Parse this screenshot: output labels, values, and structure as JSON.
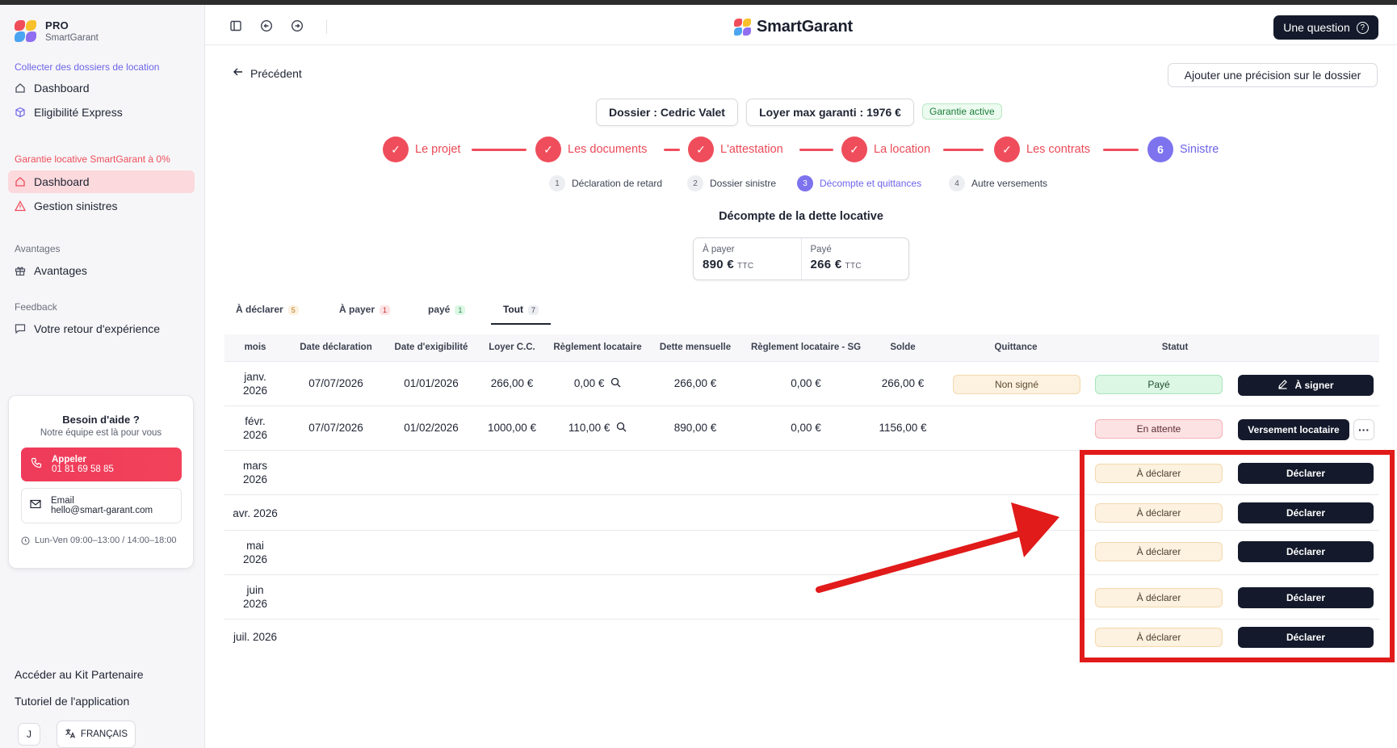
{
  "sidebar": {
    "brand": {
      "pro": "PRO",
      "name": "SmartGarant"
    },
    "sections": {
      "collect": "Collecter des dossiers de location",
      "garantie": "Garantie locative SmartGarant à 0%",
      "avantages": "Avantages",
      "feedback": "Feedback"
    },
    "items": {
      "dashboard1": "Dashboard",
      "eligibilite": "Eligibilité Express",
      "dashboard2": "Dashboard",
      "sinistres": "Gestion sinistres",
      "avantages": "Avantages",
      "retour": "Votre retour d'expérience"
    },
    "help": {
      "title": "Besoin d'aide ?",
      "subtitle": "Notre équipe est là pour vous",
      "call_label": "Appeler",
      "call_number": "01 81 69 58 85",
      "email_label": "Email",
      "email_address": "hello@smart-garant.com",
      "hours": "Lun-Ven 09:00–13:00 / 14:00–18:00"
    },
    "bottom": {
      "kit": "Accéder au Kit Partenaire",
      "tutorial": "Tutoriel de l'application",
      "avatar": "J",
      "language": "FRANÇAIS"
    }
  },
  "header": {
    "logo_text": "SmartGarant",
    "question_label": "Une question",
    "question_icon": "?"
  },
  "main": {
    "back_label": "Précédent",
    "add_precision": "Ajouter une précision sur le dossier",
    "dossier": "Dossier : Cedric Valet",
    "loyer_max": "Loyer max garanti : 1976 €",
    "garantie_status": "Garantie active",
    "steps": [
      {
        "label": "Le projet",
        "marker": "✓"
      },
      {
        "label": "Les documents",
        "marker": "✓"
      },
      {
        "label": "L'attestation",
        "marker": "✓"
      },
      {
        "label": "La location",
        "marker": "✓"
      },
      {
        "label": "Les contrats",
        "marker": "✓"
      },
      {
        "label": "Sinistre",
        "marker": "6"
      }
    ],
    "substeps": [
      {
        "num": "1",
        "label": "Déclaration de retard"
      },
      {
        "num": "2",
        "label": "Dossier sinistre"
      },
      {
        "num": "3",
        "label": "Décompte et quittances"
      },
      {
        "num": "4",
        "label": "Autre versements"
      }
    ],
    "section_title": "Décompte de la dette locative",
    "summary": {
      "a_payer_label": "À payer",
      "a_payer_value": "890 €",
      "paye_label": "Payé",
      "paye_value": "266 €",
      "unit": "TTC"
    },
    "tabs": [
      {
        "label": "À déclarer",
        "count": "5"
      },
      {
        "label": "À payer",
        "count": "1"
      },
      {
        "label": "payé",
        "count": "1"
      },
      {
        "label": "Tout",
        "count": "7"
      }
    ],
    "table": {
      "headers": [
        "mois",
        "Date déclaration",
        "Date d'exigibilité",
        "Loyer C.C.",
        "Règlement locataire",
        "Dette mensuelle",
        "Règlement locataire - SG",
        "Solde",
        "Quittance",
        "Statut"
      ],
      "rows": [
        {
          "month1": "janv.",
          "month2": "2026",
          "decl": "07/07/2026",
          "exig": "01/01/2026",
          "loyer": "266,00 €",
          "regl": "0,00 €",
          "dette": "266,00 €",
          "reglsg": "0,00 €",
          "solde": "266,00 €",
          "quittance": "Non signé",
          "statut": "Payé",
          "action": "À signer"
        },
        {
          "month1": "févr.",
          "month2": "2026",
          "decl": "07/07/2026",
          "exig": "01/02/2026",
          "loyer": "1000,00 €",
          "regl": "110,00 €",
          "dette": "890,00 €",
          "reglsg": "0,00 €",
          "solde": "1156,00 €",
          "quittance": "",
          "statut": "En attente",
          "action": "Versement locataire",
          "more": "···"
        },
        {
          "month1": "mars",
          "month2": "2026",
          "statut": "À déclarer",
          "action": "Déclarer"
        },
        {
          "month1": "avr. 2026",
          "month2": "",
          "statut": "À déclarer",
          "action": "Déclarer"
        },
        {
          "month1": "mai",
          "month2": "2026",
          "statut": "À déclarer",
          "action": "Déclarer"
        },
        {
          "month1": "juin",
          "month2": "2026",
          "statut": "À déclarer",
          "action": "Déclarer"
        },
        {
          "month1": "juil. 2026",
          "month2": "",
          "statut": "À déclarer",
          "action": "Déclarer"
        }
      ]
    }
  },
  "colors": {
    "accent_red": "#ef4d5b",
    "accent_purple": "#7d73ee",
    "dark_button": "#141a2b",
    "annotation": "#e11a1a"
  }
}
